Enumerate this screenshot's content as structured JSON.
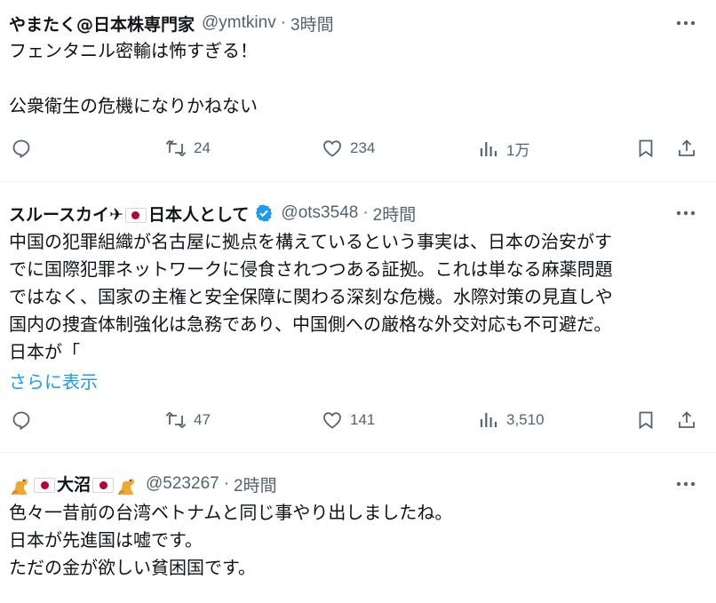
{
  "tweets": [
    {
      "name": "やまたく@日本株専門家",
      "handle": "@ymtkinv",
      "time": "3時間",
      "lines": [
        "フェンタニル密輸は怖すぎる！",
        "",
        "公衆衛生の危機になりかねない"
      ],
      "replies": "",
      "retweets": "24",
      "likes": "234",
      "views": "1万"
    },
    {
      "name_before_flag": "スルースカイ✈",
      "name_after_flag": "日本人として",
      "handle": "@ots3548",
      "time": "2時間",
      "lines": [
        "中国の犯罪組織が名古屋に拠点を構えているという事実は、日本の治安がす",
        "でに国際犯罪ネットワークに侵食されつつある証拠。これは単なる麻薬問題",
        "ではなく、国家の主権と安全保障に関わる深刻な危機。水際対策の見直しや",
        "国内の捜査体制強化は急務であり、中国側への厳格な外交対応も不可避だ。",
        "日本が「"
      ],
      "show_more": "さらに表示",
      "replies": "",
      "retweets": "47",
      "likes": "141",
      "views": "3,510"
    },
    {
      "name": "大沼",
      "handle": "@523267",
      "time": "2時間",
      "lines": [
        "色々一昔前の台湾ベトナムと同じ事やり出しましたね。",
        "日本が先進国は嘘です。",
        "ただの金が欲しい貧困国です。"
      ]
    }
  ],
  "separator": "·",
  "icons": {
    "more": "more-icon",
    "reply": "reply-icon",
    "retweet": "retweet-icon",
    "like": "heart-icon",
    "views": "views-icon",
    "bookmark": "bookmark-icon",
    "share": "share-icon",
    "verified": "verified-badge-icon",
    "cat": "cat-emoji-icon",
    "flag": "japan-flag-icon"
  },
  "colors": {
    "text": "#0f1419",
    "secondary": "#536471",
    "link": "#1d9bf0",
    "verified": "#1d9bf0",
    "divider": "#eff3f4"
  }
}
